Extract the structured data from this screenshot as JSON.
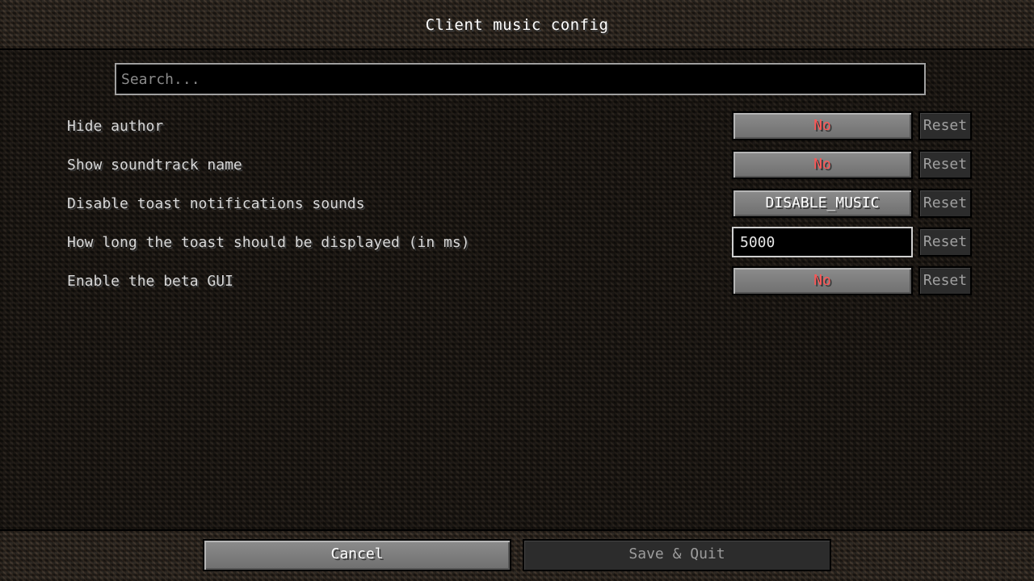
{
  "window": {
    "title": "Client music config"
  },
  "search": {
    "placeholder": "Search..."
  },
  "options": [
    {
      "label": "Hide author",
      "value": "No",
      "kind": "toggle"
    },
    {
      "label": "Show soundtrack name",
      "value": "No",
      "kind": "toggle"
    },
    {
      "label": "Disable toast notifications sounds",
      "value": "DISABLE_MUSIC",
      "kind": "enum"
    },
    {
      "label": "How long the toast should be displayed (in ms)",
      "value": "5000",
      "kind": "number"
    },
    {
      "label": "Enable the beta GUI",
      "value": "No",
      "kind": "toggle"
    }
  ],
  "reset_label": "Reset",
  "footer": {
    "cancel_label": "Cancel",
    "save_label": "Save & Quit"
  },
  "colors": {
    "value_false": "#ff5555",
    "text": "#e0e0e0",
    "disabled_text": "#a0a0a0"
  }
}
